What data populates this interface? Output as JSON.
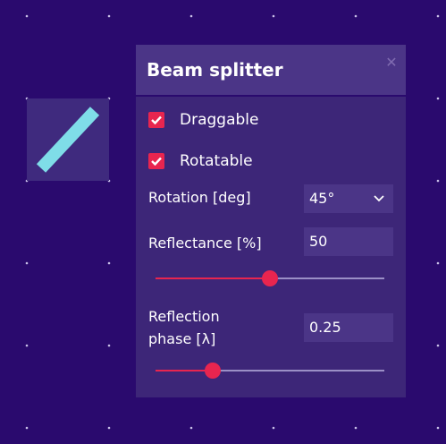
{
  "colors": {
    "background": "#2a0a6e",
    "panel": "#3d2678",
    "accent": "#e8254f",
    "beam_splitter": "#7fdde8"
  },
  "panel": {
    "title": "Beam splitter",
    "close_icon": "close-icon",
    "draggable": {
      "label": "Draggable",
      "checked": true
    },
    "rotatable": {
      "label": "Rotatable",
      "checked": true
    },
    "rotation": {
      "label": "Rotation [deg]",
      "value": "45°"
    },
    "reflectance": {
      "label": "Reflectance [%]",
      "value": "50",
      "slider_fraction": 0.5
    },
    "reflection_phase": {
      "label_line1": "Reflection",
      "label_line2": "phase [λ]",
      "value": "0.25",
      "slider_fraction": 0.25
    }
  }
}
